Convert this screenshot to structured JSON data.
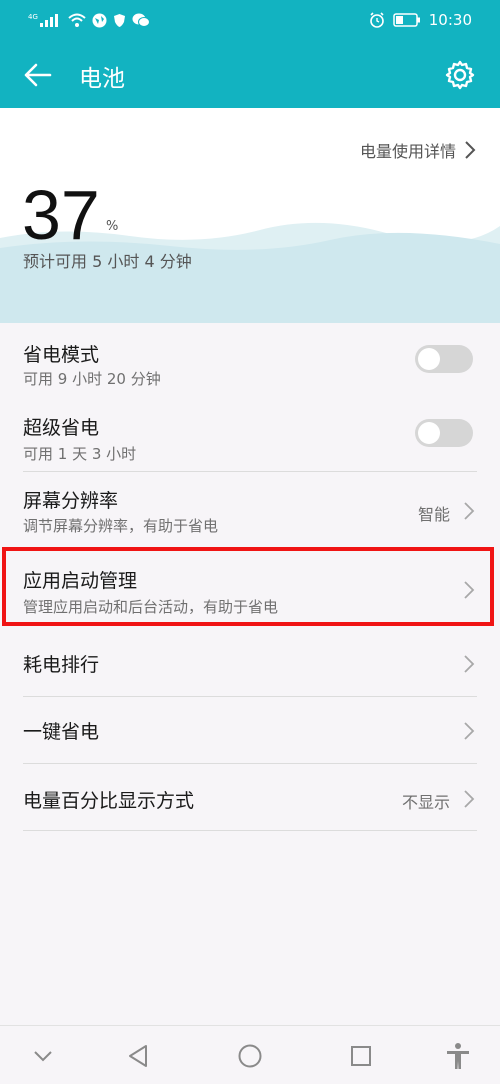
{
  "status_bar": {
    "signal_label": "4G",
    "time": "10:30",
    "icons": [
      "signal-icon",
      "wifi-icon",
      "globe-icon",
      "shield-icon",
      "wechat-icon",
      "alarm-icon",
      "battery-icon"
    ]
  },
  "app_bar": {
    "title": "电池",
    "back_icon": "arrow-left-icon",
    "settings_icon": "gear-icon"
  },
  "summary": {
    "usage_details_link": "电量使用详情",
    "percent": "37",
    "percent_unit": "%",
    "estimate": "预计可用 5 小时 4 分钟",
    "level_fraction": 0.37
  },
  "items": [
    {
      "title": "省电模式",
      "subtitle": "可用 9 小时 20 分钟",
      "control": "toggle",
      "on": false
    },
    {
      "title": "超级省电",
      "subtitle": "可用 1 天 3 小时",
      "control": "toggle",
      "on": false
    },
    {
      "title": "屏幕分辨率",
      "subtitle": "调节屏幕分辨率，有助于省电",
      "value": "智能",
      "control": "chevron"
    },
    {
      "title": "应用启动管理",
      "subtitle": "管理应用启动和后台活动，有助于省电",
      "control": "chevron",
      "highlighted": true
    },
    {
      "title": "耗电排行",
      "control": "chevron"
    },
    {
      "title": "一键省电",
      "control": "chevron"
    },
    {
      "title": "电量百分比显示方式",
      "value": "不显示",
      "control": "chevron"
    }
  ],
  "nav_bar": {
    "icons": [
      "chevron-down-icon",
      "back-triangle-icon",
      "home-circle-icon",
      "recents-square-icon",
      "accessibility-icon"
    ]
  },
  "colors": {
    "accent": "#12b3c1",
    "highlight": "#f01414",
    "wave": "#cfe8ee"
  }
}
